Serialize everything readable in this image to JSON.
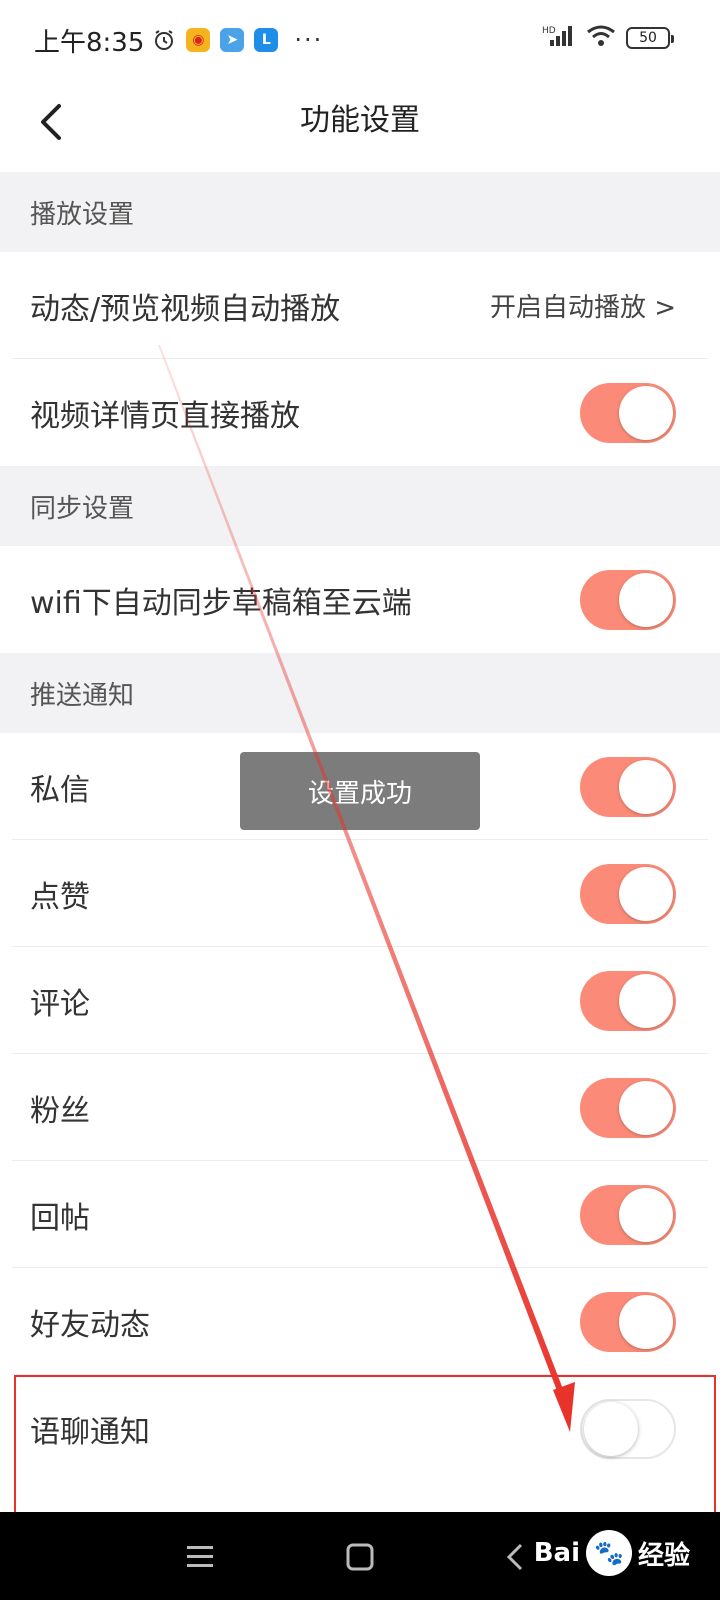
{
  "status": {
    "time": "上午8:35",
    "network": "HD",
    "battery": "50",
    "more": "···"
  },
  "header": {
    "title": "功能设置"
  },
  "sections": {
    "playback": "播放设置",
    "sync": "同步设置",
    "push": "推送通知"
  },
  "rows": {
    "autoplay_label": "动态/预览视频自动播放",
    "autoplay_value": "开启自动播放 >",
    "detail_play": "视频详情页直接播放",
    "wifi_sync": "wifi下自动同步草稿箱至云端",
    "pm": "私信",
    "like": "点赞",
    "comment": "评论",
    "fans": "粉丝",
    "reply": "回帖",
    "friend": "好友动态",
    "voice": "语聊通知"
  },
  "toggles": {
    "detail_play": true,
    "wifi_sync": true,
    "pm": true,
    "like": true,
    "comment": true,
    "fans": true,
    "reply": true,
    "friend": true,
    "voice": false
  },
  "toast": {
    "text": "设置成功"
  },
  "watermark": {
    "brand": "Bai",
    "suffix": "经验"
  },
  "colors": {
    "toggle_on": "#fb8b78",
    "annotation": "#e8332a",
    "section_bg": "#f2f2f4"
  }
}
